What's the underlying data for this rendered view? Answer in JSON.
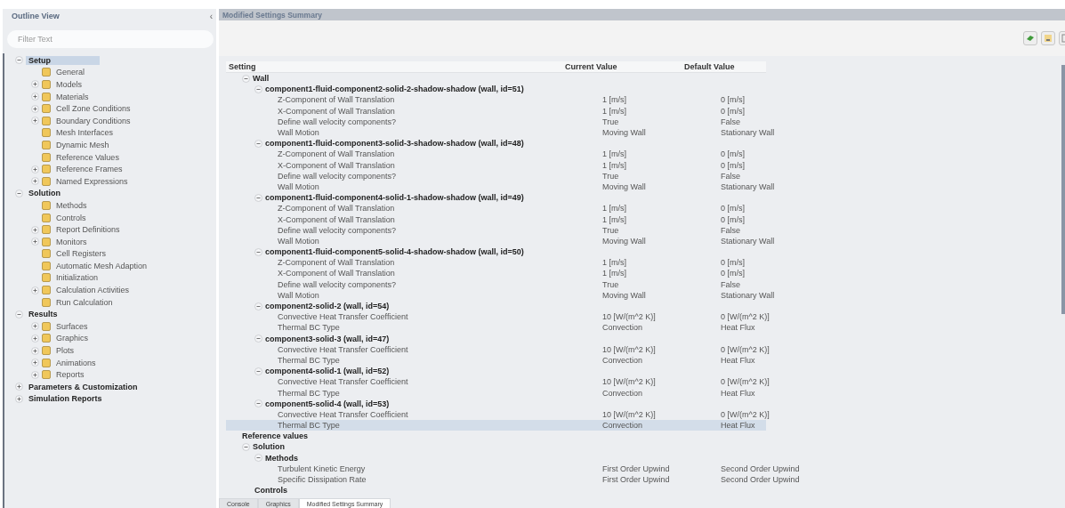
{
  "sidebar": {
    "title": "Outline View",
    "collapse_glyph": "‹",
    "filter": {
      "placeholder": "Filter Text"
    },
    "tree": [
      {
        "label": "Setup",
        "kind": "group",
        "expanded": true,
        "selected": true,
        "children": [
          {
            "label": "General",
            "kind": "leaf",
            "selected": false
          },
          {
            "label": "Models",
            "kind": "node",
            "expanded": false,
            "selected": false
          },
          {
            "label": "Materials",
            "kind": "node",
            "expanded": false,
            "selected": false
          },
          {
            "label": "Cell Zone Conditions",
            "kind": "node",
            "expanded": false,
            "selected": false
          },
          {
            "label": "Boundary Conditions",
            "kind": "node",
            "expanded": false,
            "selected": false
          },
          {
            "label": "Mesh Interfaces",
            "kind": "leaf",
            "selected": false
          },
          {
            "label": "Dynamic Mesh",
            "kind": "leaf",
            "selected": false
          },
          {
            "label": "Reference Values",
            "kind": "leaf",
            "selected": false
          },
          {
            "label": "Reference Frames",
            "kind": "node",
            "expanded": false,
            "selected": false
          },
          {
            "label": "Named Expressions",
            "kind": "node",
            "expanded": false,
            "selected": false
          }
        ]
      },
      {
        "label": "Solution",
        "kind": "group",
        "expanded": true,
        "selected": false,
        "children": [
          {
            "label": "Methods",
            "kind": "leaf",
            "selected": false
          },
          {
            "label": "Controls",
            "kind": "leaf",
            "selected": false
          },
          {
            "label": "Report Definitions",
            "kind": "node",
            "expanded": false,
            "selected": false
          },
          {
            "label": "Monitors",
            "kind": "node",
            "expanded": false,
            "selected": false
          },
          {
            "label": "Cell Registers",
            "kind": "leaf",
            "selected": false
          },
          {
            "label": "Automatic Mesh Adaption",
            "kind": "leaf",
            "selected": false
          },
          {
            "label": "Initialization",
            "kind": "leaf",
            "selected": false
          },
          {
            "label": "Calculation Activities",
            "kind": "node",
            "expanded": false,
            "selected": false
          },
          {
            "label": "Run Calculation",
            "kind": "leaf",
            "selected": false
          }
        ]
      },
      {
        "label": "Results",
        "kind": "group",
        "expanded": true,
        "selected": false,
        "children": [
          {
            "label": "Surfaces",
            "kind": "node",
            "expanded": false,
            "selected": false
          },
          {
            "label": "Graphics",
            "kind": "node",
            "expanded": false,
            "selected": false
          },
          {
            "label": "Plots",
            "kind": "node",
            "expanded": false,
            "selected": false
          },
          {
            "label": "Animations",
            "kind": "node",
            "expanded": false,
            "selected": false
          },
          {
            "label": "Reports",
            "kind": "node",
            "expanded": false,
            "selected": false
          }
        ]
      },
      {
        "label": "Parameters & Customization",
        "kind": "group",
        "expanded": false,
        "selected": false
      },
      {
        "label": "Simulation Reports",
        "kind": "group",
        "expanded": false,
        "selected": false
      }
    ]
  },
  "panel": {
    "title": "Modified Settings Summary",
    "table": {
      "columns": [
        "Setting",
        "Current Value",
        "Default Value"
      ],
      "rows": [
        {
          "label": "Wall",
          "kind": "group",
          "expanded": true,
          "selected": false,
          "children": [
            {
              "label": "component1-fluid-component2-solid-2-shadow-shadow (wall, id=51)",
              "kind": "group",
              "expanded": true,
              "selected": false,
              "children": [
                {
                  "label": "Z-Component of Wall Translation",
                  "kind": "setting",
                  "current": "1 [m/s]",
                  "default": "0 [m/s]",
                  "selected": false
                },
                {
                  "label": "X-Component of Wall Translation",
                  "kind": "setting",
                  "current": "1 [m/s]",
                  "default": "0 [m/s]",
                  "selected": false
                },
                {
                  "label": "Define wall velocity components?",
                  "kind": "setting",
                  "current": "True",
                  "default": "False",
                  "selected": false
                },
                {
                  "label": "Wall Motion",
                  "kind": "setting",
                  "current": "Moving Wall",
                  "default": "Stationary Wall",
                  "selected": false
                }
              ]
            },
            {
              "label": "component1-fluid-component3-solid-3-shadow-shadow (wall, id=48)",
              "kind": "group",
              "expanded": true,
              "selected": false,
              "children": [
                {
                  "label": "Z-Component of Wall Translation",
                  "kind": "setting",
                  "current": "1 [m/s]",
                  "default": "0 [m/s]",
                  "selected": false
                },
                {
                  "label": "X-Component of Wall Translation",
                  "kind": "setting",
                  "current": "1 [m/s]",
                  "default": "0 [m/s]",
                  "selected": false
                },
                {
                  "label": "Define wall velocity components?",
                  "kind": "setting",
                  "current": "True",
                  "default": "False",
                  "selected": false
                },
                {
                  "label": "Wall Motion",
                  "kind": "setting",
                  "current": "Moving Wall",
                  "default": "Stationary Wall",
                  "selected": false
                }
              ]
            },
            {
              "label": "component1-fluid-component4-solid-1-shadow-shadow (wall, id=49)",
              "kind": "group",
              "expanded": true,
              "selected": false,
              "children": [
                {
                  "label": "Z-Component of Wall Translation",
                  "kind": "setting",
                  "current": "1 [m/s]",
                  "default": "0 [m/s]",
                  "selected": false
                },
                {
                  "label": "X-Component of Wall Translation",
                  "kind": "setting",
                  "current": "1 [m/s]",
                  "default": "0 [m/s]",
                  "selected": false
                },
                {
                  "label": "Define wall velocity components?",
                  "kind": "setting",
                  "current": "True",
                  "default": "False",
                  "selected": false
                },
                {
                  "label": "Wall Motion",
                  "kind": "setting",
                  "current": "Moving Wall",
                  "default": "Stationary Wall",
                  "selected": false
                }
              ]
            },
            {
              "label": "component1-fluid-component5-solid-4-shadow-shadow (wall, id=50)",
              "kind": "group",
              "expanded": true,
              "selected": false,
              "children": [
                {
                  "label": "Z-Component of Wall Translation",
                  "kind": "setting",
                  "current": "1 [m/s]",
                  "default": "0 [m/s]",
                  "selected": false
                },
                {
                  "label": "X-Component of Wall Translation",
                  "kind": "setting",
                  "current": "1 [m/s]",
                  "default": "0 [m/s]",
                  "selected": false
                },
                {
                  "label": "Define wall velocity components?",
                  "kind": "setting",
                  "current": "True",
                  "default": "False",
                  "selected": false
                },
                {
                  "label": "Wall Motion",
                  "kind": "setting",
                  "current": "Moving Wall",
                  "default": "Stationary Wall",
                  "selected": false
                }
              ]
            },
            {
              "label": "component2-solid-2 (wall, id=54)",
              "kind": "group",
              "expanded": true,
              "selected": false,
              "children": [
                {
                  "label": "Convective Heat Transfer Coefficient",
                  "kind": "setting",
                  "current": "10 [W/(m^2 K)]",
                  "default": "0 [W/(m^2 K)]",
                  "selected": false
                },
                {
                  "label": "Thermal BC Type",
                  "kind": "setting",
                  "current": "Convection",
                  "default": "Heat Flux",
                  "selected": false
                }
              ]
            },
            {
              "label": "component3-solid-3 (wall, id=47)",
              "kind": "group",
              "expanded": true,
              "selected": false,
              "children": [
                {
                  "label": "Convective Heat Transfer Coefficient",
                  "kind": "setting",
                  "current": "10 [W/(m^2 K)]",
                  "default": "0 [W/(m^2 K)]",
                  "selected": false
                },
                {
                  "label": "Thermal BC Type",
                  "kind": "setting",
                  "current": "Convection",
                  "default": "Heat Flux",
                  "selected": false
                }
              ]
            },
            {
              "label": "component4-solid-1 (wall, id=52)",
              "kind": "group",
              "expanded": true,
              "selected": false,
              "children": [
                {
                  "label": "Convective Heat Transfer Coefficient",
                  "kind": "setting",
                  "current": "10 [W/(m^2 K)]",
                  "default": "0 [W/(m^2 K)]",
                  "selected": false
                },
                {
                  "label": "Thermal BC Type",
                  "kind": "setting",
                  "current": "Convection",
                  "default": "Heat Flux",
                  "selected": false
                }
              ]
            },
            {
              "label": "component5-solid-4 (wall, id=53)",
              "kind": "group",
              "expanded": true,
              "selected": false,
              "children": [
                {
                  "label": "Convective Heat Transfer Coefficient",
                  "kind": "setting",
                  "current": "10 [W/(m^2 K)]",
                  "default": "0 [W/(m^2 K)]",
                  "selected": false
                },
                {
                  "label": "Thermal BC Type",
                  "kind": "setting",
                  "current": "Convection",
                  "default": "Heat Flux",
                  "selected": true
                }
              ]
            }
          ]
        },
        {
          "label": "Reference values",
          "kind": "label",
          "selected": false
        },
        {
          "label": "Solution",
          "kind": "group",
          "expanded": true,
          "selected": false,
          "children": [
            {
              "label": "Methods",
              "kind": "group",
              "expanded": true,
              "selected": false,
              "children": [
                {
                  "label": "Turbulent Kinetic Energy",
                  "kind": "setting",
                  "current": "First Order Upwind",
                  "default": "Second Order Upwind",
                  "selected": false
                },
                {
                  "label": "Specific Dissipation Rate",
                  "kind": "setting",
                  "current": "First Order Upwind",
                  "default": "Second Order Upwind",
                  "selected": false
                }
              ]
            },
            {
              "label": "Controls",
              "kind": "label",
              "selected": false
            }
          ]
        }
      ]
    }
  },
  "bottom_tabs": [
    {
      "label": "Console",
      "selected": false
    },
    {
      "label": "Graphics",
      "selected": false
    },
    {
      "label": "Modified Settings Summary",
      "selected": true
    }
  ]
}
